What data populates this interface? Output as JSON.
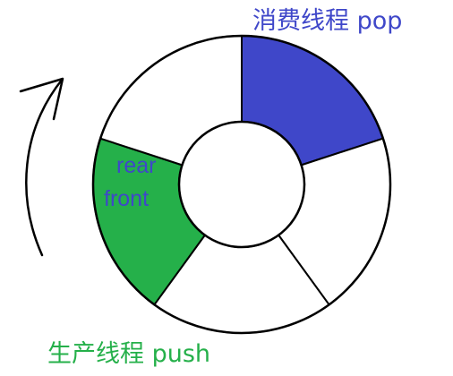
{
  "labels": {
    "consumer": "消费线程 pop",
    "producer": "生产线程 push",
    "rear": "rear",
    "front": "front"
  },
  "ring": {
    "segment_count": 5,
    "highlighted_segments": [
      {
        "index": 0,
        "role": "consumer",
        "color": "#3f47c9"
      },
      {
        "index": 3,
        "role": "producer",
        "color": "#25b04a"
      }
    ],
    "default_fill": "#ffffff",
    "stroke_color": "#000000"
  },
  "colors": {
    "consumer_text": "#3f47c9",
    "producer_text": "#25b04a",
    "pointer_text": "#3f47c9",
    "arrow": "#000000"
  },
  "icons": {
    "rotation_arrow": "curved-up-arrow-icon"
  }
}
